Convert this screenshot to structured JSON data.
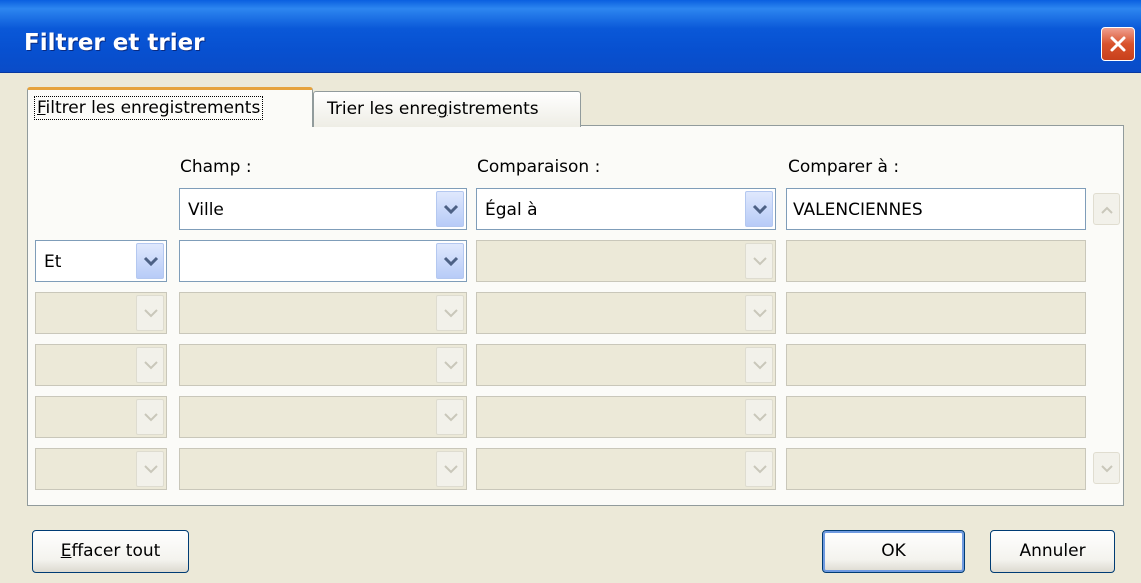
{
  "dialog": {
    "title": "Filtrer et trier"
  },
  "tabs": {
    "filter": {
      "first": "F",
      "rest": "iltrer les enregistrements"
    },
    "sort": {
      "pre": "Trier les enre",
      "ul": "g",
      "post": "istrements"
    }
  },
  "headers": {
    "field": "Champ :",
    "comparison": "Comparaison :",
    "compare_to": "Comparer à :"
  },
  "rows": [
    {
      "conjunction": "",
      "field": "Ville",
      "comparison": "Égal à",
      "value": "VALENCIENNES"
    },
    {
      "conjunction": "Et",
      "field": "",
      "comparison": "",
      "value": ""
    },
    {
      "conjunction": "",
      "field": "",
      "comparison": "",
      "value": ""
    },
    {
      "conjunction": "",
      "field": "",
      "comparison": "",
      "value": ""
    },
    {
      "conjunction": "",
      "field": "",
      "comparison": "",
      "value": ""
    },
    {
      "conjunction": "",
      "field": "",
      "comparison": "",
      "value": ""
    }
  ],
  "buttons": {
    "clear_all": {
      "first": "E",
      "rest": "ffacer tout"
    },
    "ok": "OK",
    "cancel": "Annuler"
  },
  "icons": {
    "close": "close-icon",
    "dropdown": "chevron-down-icon",
    "scroll_up": "scroll-up-icon",
    "scroll_down": "scroll-down-icon"
  },
  "colors": {
    "titlebar": "#0a58d8",
    "face": "#ece9d8",
    "tab_highlight": "#e6a23c",
    "close": "#d9532c"
  }
}
